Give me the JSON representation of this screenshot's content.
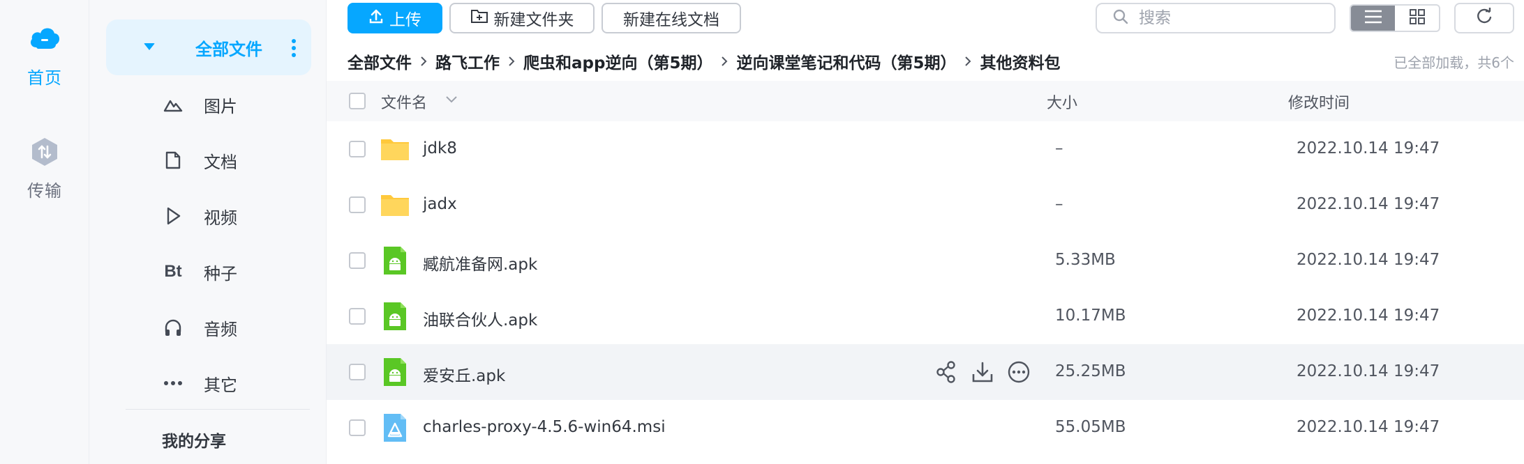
{
  "rail": {
    "home_label": "首页",
    "transfer_label": "传输"
  },
  "sidebar": {
    "all_files": "全部文件",
    "items": [
      {
        "label": "图片",
        "icon": "image-icon"
      },
      {
        "label": "文档",
        "icon": "document-icon"
      },
      {
        "label": "视频",
        "icon": "video-icon"
      },
      {
        "label": "种子",
        "icon": "torrent-icon"
      },
      {
        "label": "音频",
        "icon": "audio-icon"
      },
      {
        "label": "其它",
        "icon": "more-icon"
      }
    ],
    "my_share": "我的分享"
  },
  "toolbar": {
    "upload": "上传",
    "new_folder": "新建文件夹",
    "new_online_doc": "新建在线文档",
    "search_placeholder": "搜索"
  },
  "breadcrumb": [
    "全部文件",
    "路飞工作",
    "爬虫和app逆向（第5期）",
    "逆向课堂笔记和代码（第5期）",
    "其他资料包"
  ],
  "load_status": "已全部加载，共6个",
  "table": {
    "headers": {
      "name": "文件名",
      "size": "大小",
      "modified": "修改时间"
    },
    "rows": [
      {
        "name": "jdk8",
        "type": "folder",
        "size": "–",
        "modified": "2022.10.14 19:47"
      },
      {
        "name": "jadx",
        "type": "folder",
        "size": "–",
        "modified": "2022.10.14 19:47"
      },
      {
        "name": "臧航准备网.apk",
        "type": "apk",
        "size": "5.33MB",
        "modified": "2022.10.14 19:47"
      },
      {
        "name": "油联合伙人.apk",
        "type": "apk",
        "size": "10.17MB",
        "modified": "2022.10.14 19:47"
      },
      {
        "name": "爱安丘.apk",
        "type": "apk",
        "size": "25.25MB",
        "modified": "2022.10.14 19:47",
        "hovered": true
      },
      {
        "name": "charles-proxy-4.5.6-win64.msi",
        "type": "msi",
        "size": "55.05MB",
        "modified": "2022.10.14 19:47"
      }
    ]
  },
  "colors": {
    "accent": "#06a7ff",
    "folder": "#ffc93c",
    "apk": "#5ac725",
    "msi": "#62bdf5"
  }
}
